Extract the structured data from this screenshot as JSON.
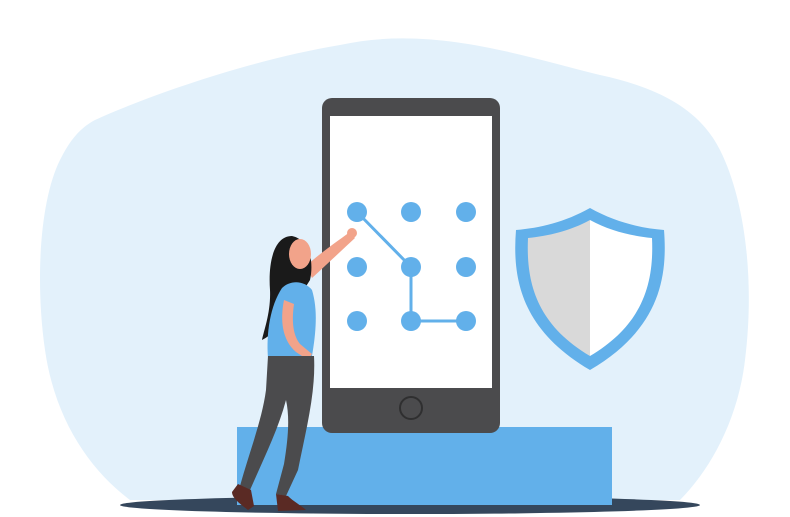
{
  "scene": {
    "description_visible_text": "",
    "colors": {
      "background_blob": "#e3f1fb",
      "phone_frame": "#4b4b4d",
      "phone_screen": "#ffffff",
      "pattern_dot": "#62b0ea",
      "pattern_line": "#62b0ea",
      "pedestal": "#62b0ea",
      "ground_shadow": "#35475c",
      "shield_outer": "#62b0ea",
      "shield_left": "#d9d9d9",
      "shield_right": "#ffffff",
      "hair": "#1a1a1a",
      "skin": "#f2a38a",
      "shirt": "#62b0ea",
      "pants": "#4b4b4d",
      "shoes": "#5a2a24"
    },
    "icons": {
      "phone": "smartphone-icon",
      "shield": "shield-icon",
      "pattern": "pattern-lock-icon",
      "person": "woman-figure"
    },
    "pattern_lock": {
      "grid": "3x3",
      "path_order": [
        0,
        4,
        7,
        8
      ]
    }
  }
}
